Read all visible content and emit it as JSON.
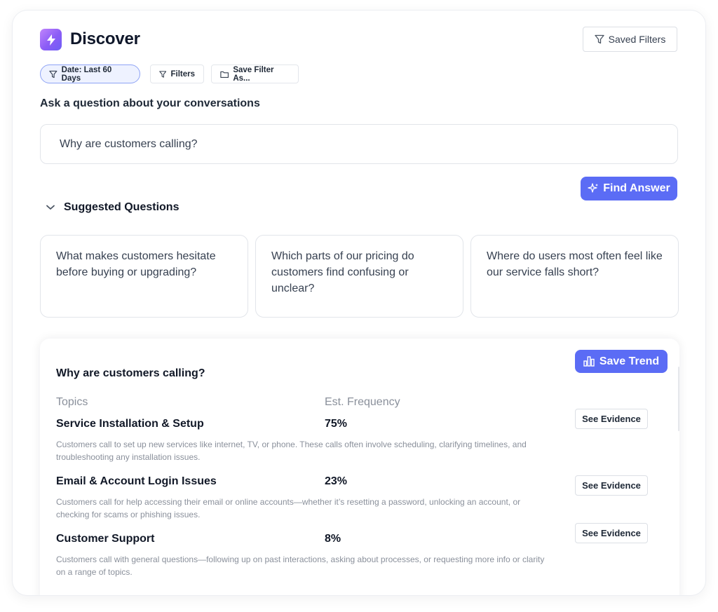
{
  "header": {
    "title": "Discover",
    "saved_filters_label": "Saved Filters"
  },
  "chips": {
    "date": "Date: Last 60 Days",
    "filters": "Filters",
    "save_filter_as": "Save Filter As..."
  },
  "ask": {
    "label": "Ask a question about your conversations",
    "input_value": "Why are customers calling?",
    "find_answer_label": "Find Answer"
  },
  "suggested": {
    "title": "Suggested Questions",
    "items": [
      "What makes customers hesitate before buying or upgrading?",
      "Which parts of our pricing do customers find confusing or unclear?",
      "Where do users most often feel like our service falls short?"
    ]
  },
  "results": {
    "title": "Why are customers calling?",
    "save_trend_label": "Save Trend",
    "columns": {
      "topics": "Topics",
      "frequency": "Est. Frequency"
    },
    "evidence_label": "See Evidence",
    "rows": [
      {
        "title": "Service Installation & Setup",
        "pct": "75%",
        "desc": "Customers call to set up new services like internet, TV, or phone. These calls often involve scheduling, clarifying timelines, and troubleshooting any installation issues."
      },
      {
        "title": "Email & Account Login Issues",
        "pct": "23%",
        "desc": "Customers call for help accessing their email or online accounts—whether it’s resetting a password, unlocking an account, or checking for scams or phishing issues."
      },
      {
        "title": "Customer Support",
        "pct": "8%",
        "desc": "Customers call with general questions—following up on past interactions, asking about processes, or requesting more info or clarity on a range of topics."
      }
    ]
  },
  "colors": {
    "accent": "#5b6cf5",
    "chip_active_bg": "#eef2ff",
    "chip_active_border": "#8ea3f5",
    "muted_text": "#8a909b"
  },
  "icons": {
    "app": "lightning-icon",
    "saved_filters": "funnel-icon",
    "filters": "funnel-icon",
    "save_as": "folder-icon",
    "find_answer": "sparkles-icon",
    "suggested_toggle": "chevron-down-icon",
    "save_trend": "bar-chart-icon"
  }
}
